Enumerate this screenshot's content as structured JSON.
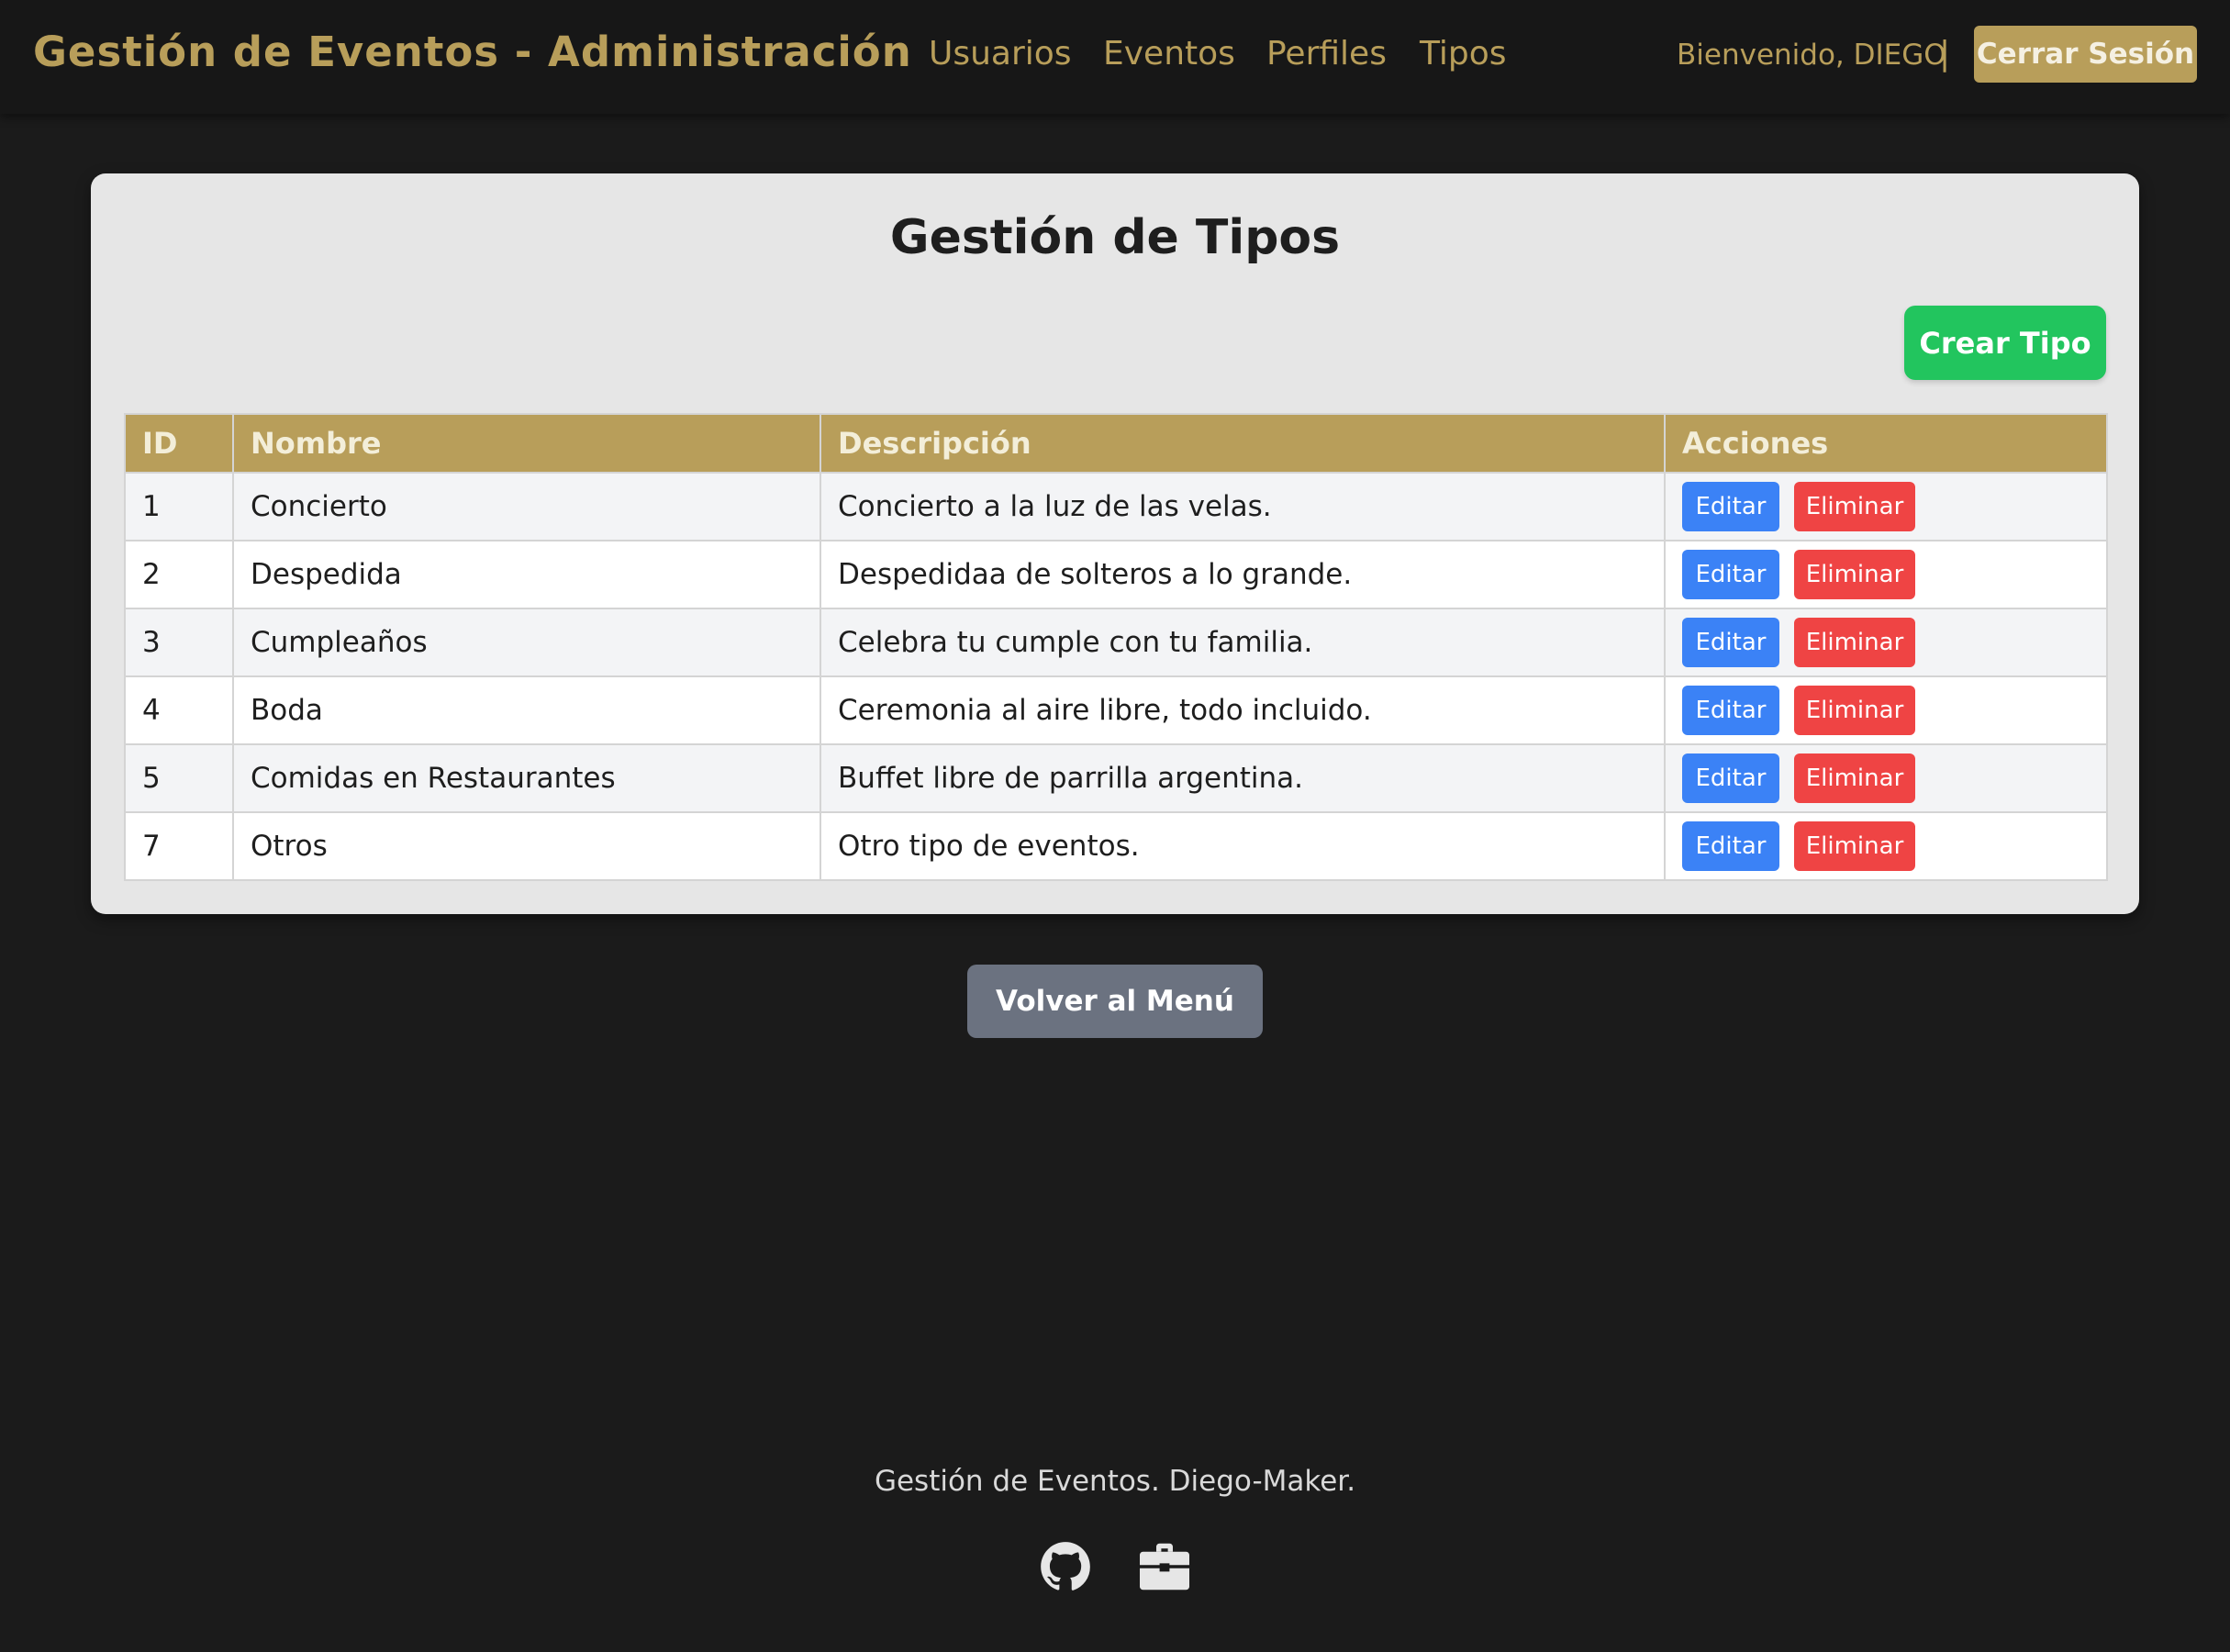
{
  "header": {
    "brand": "Gestión de Eventos - Administración",
    "nav": [
      "Usuarios",
      "Eventos",
      "Perfiles",
      "Tipos"
    ],
    "welcome": "Bienvenido, DIEGO",
    "separator": "|",
    "logout_label": "Cerrar Sesión"
  },
  "main": {
    "title": "Gestión de Tipos",
    "create_label": "Crear Tipo",
    "table": {
      "headers": [
        "ID",
        "Nombre",
        "Descripción",
        "Acciones"
      ],
      "rows": [
        {
          "id": "1",
          "nombre": "Concierto",
          "descripcion": "Concierto a la luz de las velas."
        },
        {
          "id": "2",
          "nombre": "Despedida",
          "descripcion": "Despedidaa de solteros a lo grande."
        },
        {
          "id": "3",
          "nombre": "Cumpleaños",
          "descripcion": "Celebra tu cumple con tu familia."
        },
        {
          "id": "4",
          "nombre": "Boda",
          "descripcion": "Ceremonia al aire libre, todo incluido."
        },
        {
          "id": "5",
          "nombre": "Comidas en Restaurantes",
          "descripcion": "Buffet libre de parrilla argentina."
        },
        {
          "id": "7",
          "nombre": "Otros",
          "descripcion": "Otro tipo de eventos."
        }
      ],
      "edit_label": "Editar",
      "delete_label": "Eliminar"
    },
    "back_label": "Volver al Menú"
  },
  "footer": {
    "text": "Gestión de Eventos. Diego-Maker.",
    "icons": [
      "github-icon",
      "briefcase-icon"
    ]
  },
  "colors": {
    "background": "#1b1b1b",
    "accent_gold": "#b89e5a",
    "create_green": "#22c55e",
    "edit_blue": "#3b82f6",
    "delete_red": "#ef4444",
    "back_gray": "#6b7280"
  }
}
